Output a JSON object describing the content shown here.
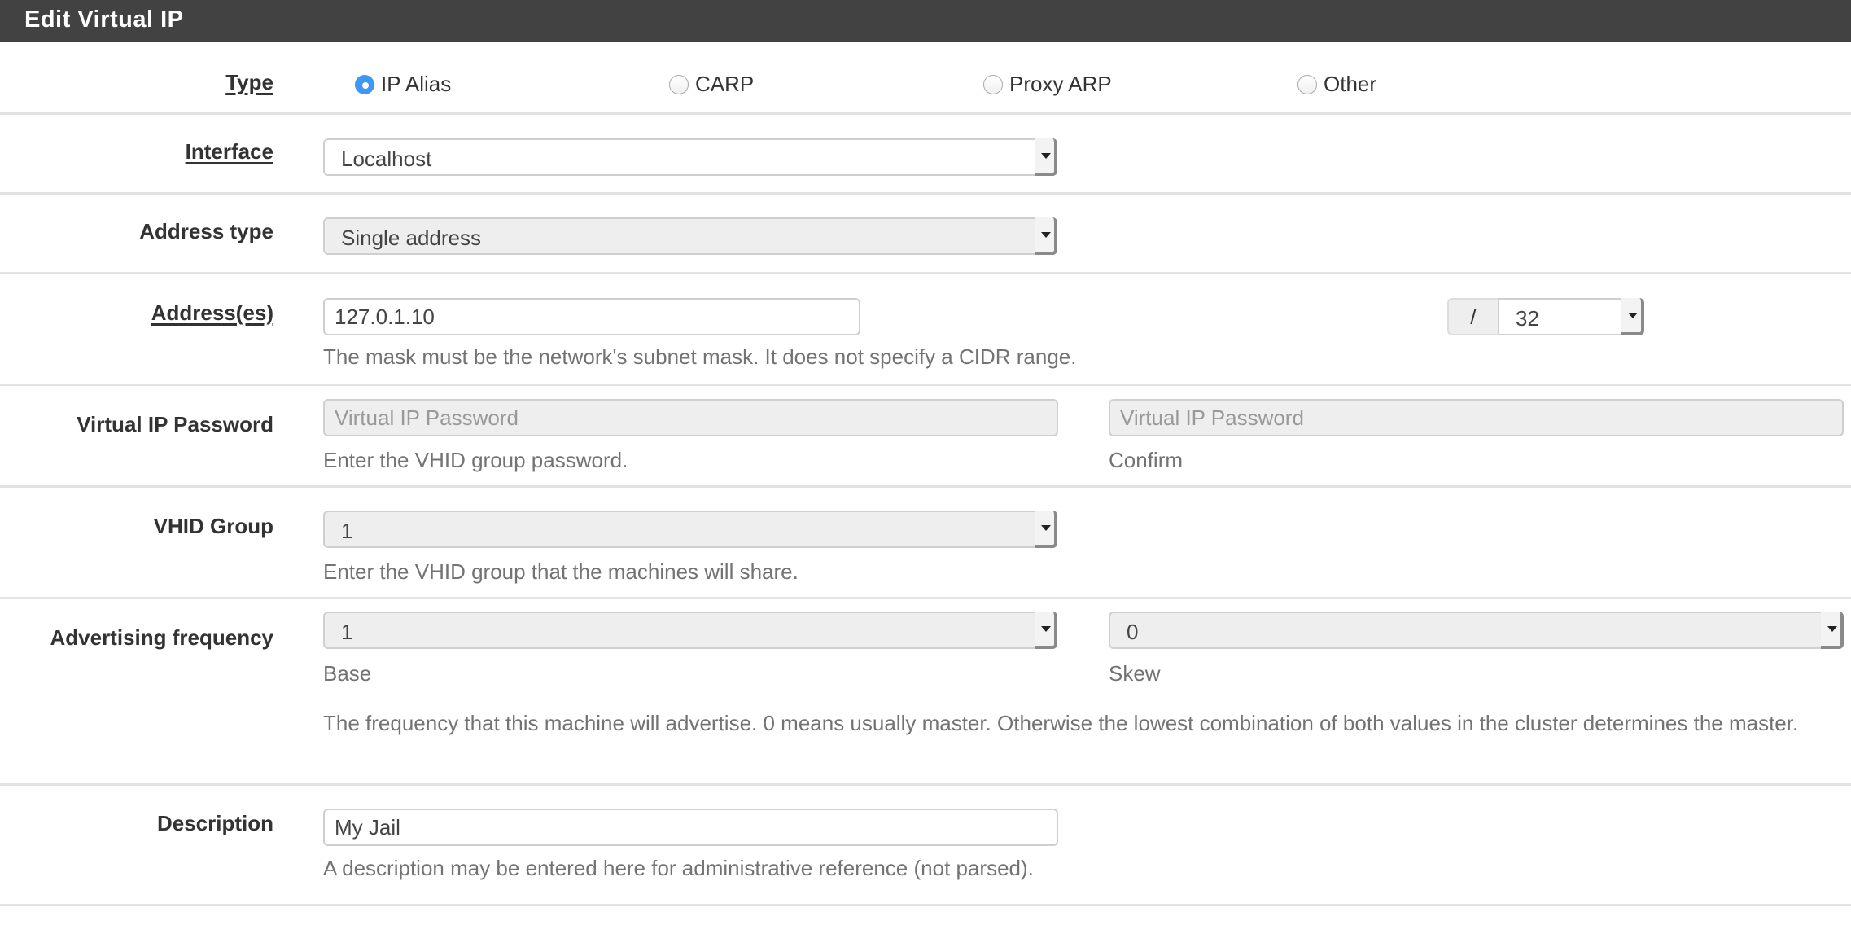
{
  "header": {
    "title": "Edit Virtual IP"
  },
  "type": {
    "label": "Type",
    "options": [
      {
        "label": "IP Alias",
        "checked": true
      },
      {
        "label": "CARP",
        "checked": false
      },
      {
        "label": "Proxy ARP",
        "checked": false
      },
      {
        "label": "Other",
        "checked": false
      }
    ]
  },
  "interface": {
    "label": "Interface",
    "value": "Localhost"
  },
  "address_type": {
    "label": "Address type",
    "value": "Single address"
  },
  "addresses": {
    "label": "Address(es)",
    "value": "127.0.1.10",
    "separator": "/",
    "mask": "32",
    "help": "The mask must be the network's subnet mask. It does not specify a CIDR range."
  },
  "vip_password": {
    "label": "Virtual IP Password",
    "placeholder": "Virtual IP Password",
    "confirm_placeholder": "Virtual IP Password",
    "help": "Enter the VHID group password.",
    "confirm_help": "Confirm"
  },
  "vhid_group": {
    "label": "VHID Group",
    "value": "1",
    "help": "Enter the VHID group that the machines will share."
  },
  "advertising_frequency": {
    "label": "Advertising frequency",
    "base_value": "1",
    "base_help": "Base",
    "skew_value": "0",
    "skew_help": "Skew",
    "help": "The frequency that this machine will advertise. 0 means usually master. Otherwise the lowest combination of both values in the cluster determines the master."
  },
  "description": {
    "label": "Description",
    "value": "My Jail",
    "help": "A description may be entered here for administrative reference (not parsed)."
  }
}
